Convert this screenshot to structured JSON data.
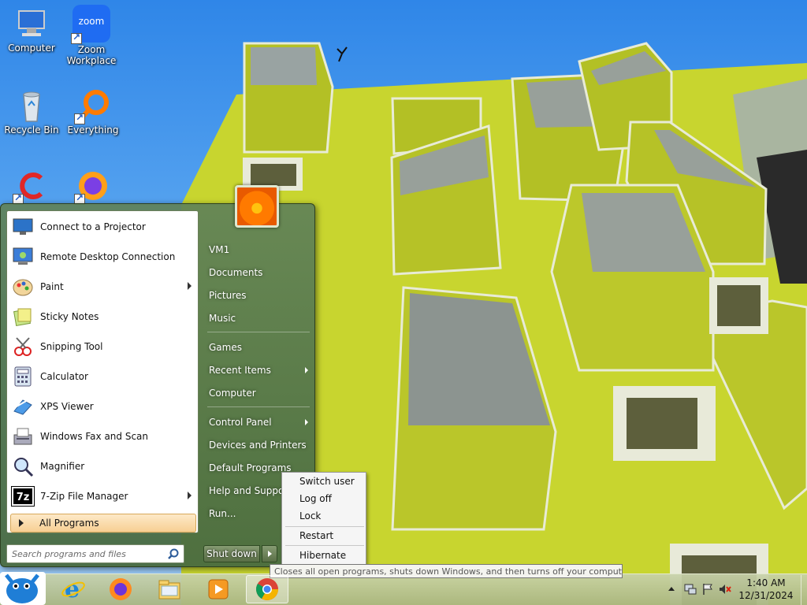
{
  "desktop": {
    "icons": [
      {
        "label": "Computer",
        "icon": "computer-icon"
      },
      {
        "label": "Zoom\nWorkplace",
        "icon": "zoom-icon",
        "logo_text": "zoom"
      },
      {
        "label": "Recycle Bin",
        "icon": "recycle-bin-icon"
      },
      {
        "label": "Everything",
        "icon": "everything-icon"
      },
      {
        "label": "",
        "icon": "ccleaner-icon"
      },
      {
        "label": "",
        "icon": "firefox-icon"
      }
    ]
  },
  "start_menu": {
    "pinned_programs": [
      {
        "label": "Connect to a Projector",
        "icon": "projector-icon",
        "has_submenu": false
      },
      {
        "label": "Remote Desktop Connection",
        "icon": "remote-desktop-icon",
        "has_submenu": false
      },
      {
        "label": "Paint",
        "icon": "paint-icon",
        "has_submenu": true
      },
      {
        "label": "Sticky Notes",
        "icon": "sticky-notes-icon",
        "has_submenu": false
      },
      {
        "label": "Snipping Tool",
        "icon": "snipping-tool-icon",
        "has_submenu": false
      },
      {
        "label": "Calculator",
        "icon": "calculator-icon",
        "has_submenu": false
      },
      {
        "label": "XPS Viewer",
        "icon": "xps-viewer-icon",
        "has_submenu": false
      },
      {
        "label": "Windows Fax and Scan",
        "icon": "fax-scan-icon",
        "has_submenu": false
      },
      {
        "label": "Magnifier",
        "icon": "magnifier-icon",
        "has_submenu": false
      },
      {
        "label": "7-Zip File Manager",
        "icon": "7zip-icon",
        "has_submenu": true,
        "logo_text": "7z"
      }
    ],
    "all_programs_label": "All Programs",
    "search_placeholder": "Search programs and files",
    "right_items": [
      {
        "label": "VM1",
        "has_submenu": false
      },
      {
        "label": "Documents",
        "has_submenu": false
      },
      {
        "label": "Pictures",
        "has_submenu": false
      },
      {
        "label": "Music",
        "has_submenu": false
      },
      {
        "label": "Games",
        "has_submenu": false
      },
      {
        "label": "Recent Items",
        "has_submenu": true
      },
      {
        "label": "Computer",
        "has_submenu": false
      },
      {
        "label": "Control Panel",
        "has_submenu": true
      },
      {
        "label": "Devices and Printers",
        "has_submenu": false
      },
      {
        "label": "Default Programs",
        "has_submenu": false
      },
      {
        "label": "Help and Support",
        "has_submenu": false
      },
      {
        "label": "Run...",
        "has_submenu": false
      }
    ],
    "shutdown_label": "Shut down"
  },
  "shutdown_menu": {
    "items": [
      "Switch user",
      "Log off",
      "Lock",
      "Restart",
      "Hibernate"
    ]
  },
  "tooltip": "Closes all open programs, shuts down Windows, and then turns off your computer.",
  "taskbar": {
    "pinned": [
      {
        "name": "internet-explorer-icon"
      },
      {
        "name": "firefox-icon"
      },
      {
        "name": "file-explorer-icon"
      },
      {
        "name": "media-player-icon"
      },
      {
        "name": "chrome-icon",
        "active": true
      }
    ],
    "clock_time": "1:40 AM",
    "clock_date": "12/31/2024"
  }
}
